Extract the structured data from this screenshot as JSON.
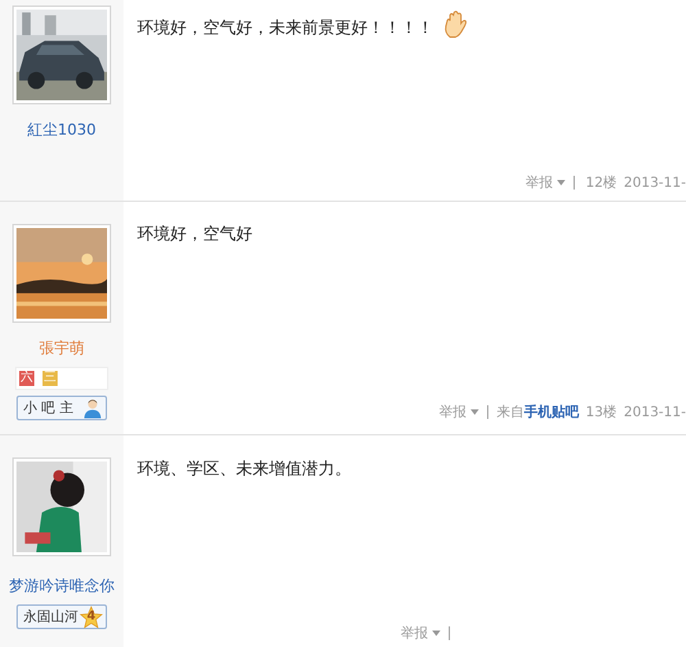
{
  "posts": [
    {
      "username": "紅尘1030",
      "color": "#2d64b3",
      "content": "环境好，空气好，未来前景更好！！！！",
      "emoji": true,
      "footer": {
        "report": "举报",
        "floor": "12楼",
        "date": "2013-11-"
      }
    },
    {
      "username": "張宇萌",
      "color": "#e07b39",
      "level_icons": [
        {
          "text": "六",
          "color": "#e05a55"
        },
        {
          "text": "三",
          "color": "#e8b948"
        }
      ],
      "title_badge": {
        "text": "小 吧 主",
        "kind": "person"
      },
      "content": "环境好，空气好",
      "footer": {
        "report": "举报",
        "source_prefix": "来自",
        "source_link": "手机贴吧",
        "floor": "13楼",
        "date": "2013-11-"
      }
    },
    {
      "username": "梦游吟诗唯念你",
      "color": "#2d64b3",
      "title_badge": {
        "text": "永固山河",
        "kind": "star",
        "level_text": "4"
      },
      "content": "环境、学区、未来增值潜力。",
      "footer": {
        "report": "举报"
      }
    }
  ]
}
